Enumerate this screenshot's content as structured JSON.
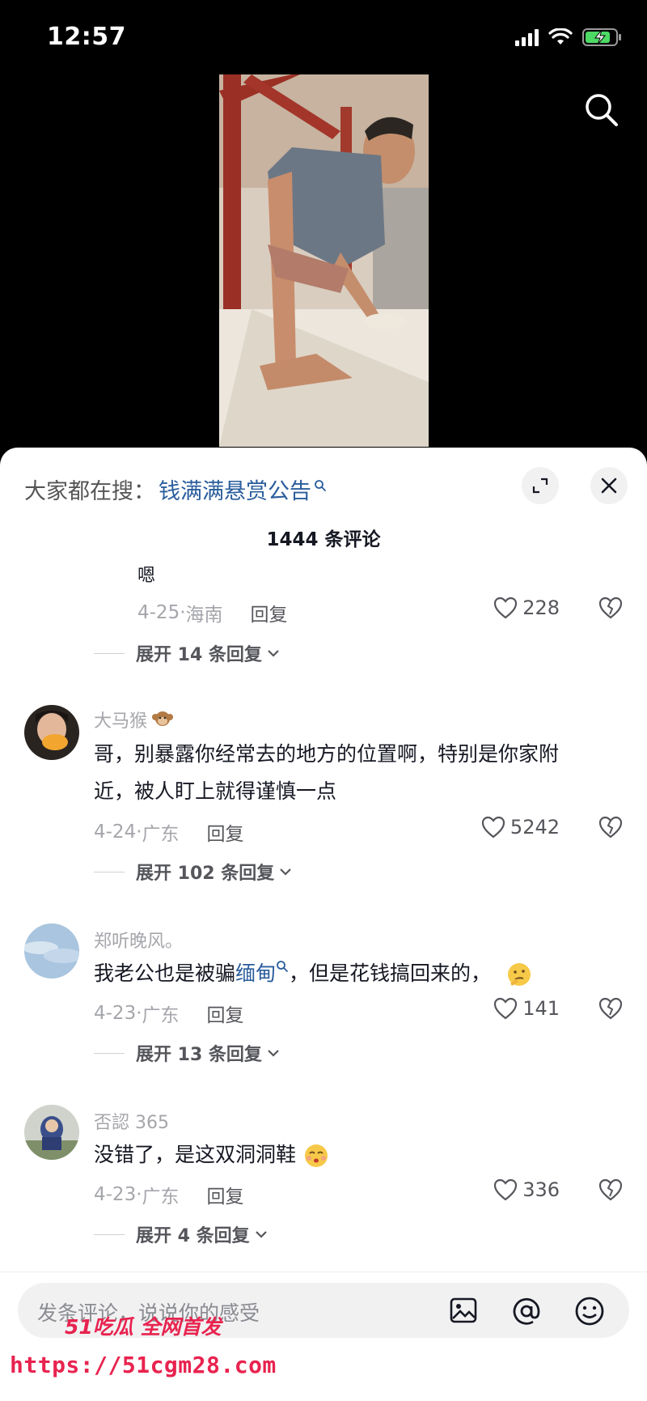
{
  "status": {
    "time": "12:57"
  },
  "trending": {
    "prefix": "大家都在搜：",
    "keyword": "钱满满悬赏公告"
  },
  "comment_count": "1444 条评论",
  "comments": [
    {
      "text": "嗯",
      "date": "4-25",
      "region": "海南",
      "reply_label": "回复",
      "likes": "228",
      "expand": "展开 14 条回复"
    },
    {
      "user": "大马猴",
      "text_line1": "哥，别暴露你经常去的地方的位置啊，特别是你家附",
      "text_line2": "近，被人盯上就得谨慎一点",
      "date": "4-24",
      "region": "广东",
      "reply_label": "回复",
      "likes": "5242",
      "expand": "展开 102 条回复"
    },
    {
      "user": "郑听晚风。",
      "text_before": "我老公也是被骗",
      "text_link": "缅甸",
      "text_after": "，但是花钱搞回来的，",
      "date": "4-23",
      "region": "广东",
      "reply_label": "回复",
      "likes": "141",
      "expand": "展开 13 条回复"
    },
    {
      "user": "否認 365",
      "text": "没错了，是这双洞洞鞋",
      "date": "4-23",
      "region": "广东",
      "reply_label": "回复",
      "likes": "336",
      "expand": "展开 4 条回复"
    }
  ],
  "input": {
    "placeholder": "发条评论，说说你的感受"
  },
  "watermark": {
    "logo": "51吃瓜 全网首发",
    "url": "https://51cgm28.com"
  }
}
